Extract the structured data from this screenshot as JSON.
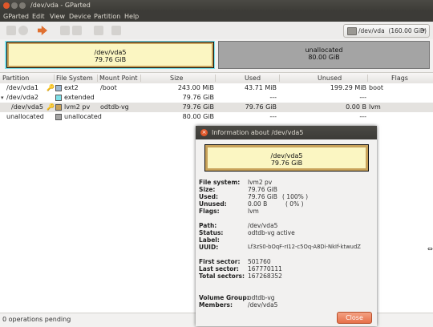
{
  "window": {
    "title": "/dev/vda - GParted"
  },
  "menu": [
    "GParted",
    "Edit",
    "View",
    "Device",
    "Partition",
    "Help"
  ],
  "toolbar": {
    "icons": [
      "new-icon",
      "delete-icon",
      "apply-icon",
      "copy-icon",
      "paste-icon",
      "undo-icon",
      "resize-icon"
    ]
  },
  "device_selector": {
    "label": "/dev/vda",
    "size": "(160.00 GiB)"
  },
  "diskmap": {
    "lvm": {
      "name": "/dev/vda5",
      "size": "79.76 GiB"
    },
    "unallocated": {
      "name": "unallocated",
      "size": "80.00 GiB"
    }
  },
  "table": {
    "headers": [
      "Partition",
      "File System",
      "Mount Point",
      "Size",
      "Used",
      "Unused",
      "Flags"
    ],
    "rows": [
      {
        "partition": "/dev/vda1",
        "fs": "ext2",
        "fs_color": "#9db8d2",
        "mount": "/boot",
        "size": "243.00 MiB",
        "used": "43.71 MiB",
        "unused": "199.29 MiB",
        "flags": "boot",
        "key": "🔑"
      },
      {
        "partition": "/dev/vda2",
        "fs": "extended",
        "fs_color": "#7ee0e8",
        "mount": "",
        "size": "79.76 GiB",
        "used": "---",
        "unused": "---",
        "flags": "",
        "key": ""
      },
      {
        "partition": "/dev/vda5",
        "fs": "lvm2 pv",
        "fs_color": "#c8a25a",
        "mount": "odtdb-vg",
        "size": "79.76 GiB",
        "used": "79.76 GiB",
        "unused": "0.00 B",
        "flags": "lvm",
        "key": "🔑"
      },
      {
        "partition": "unallocated",
        "fs": "unallocated",
        "fs_color": "#a4a4a4",
        "mount": "",
        "size": "80.00 GiB",
        "used": "---",
        "unused": "---",
        "flags": "",
        "key": ""
      }
    ]
  },
  "status": {
    "text": "0 operations pending"
  },
  "dialog": {
    "title": "Information about /dev/vda5",
    "partition_name": "/dev/vda5",
    "partition_size": "79.76 GiB",
    "labels": {
      "filesystem": "File system:",
      "size": "Size:",
      "used": "Used:",
      "unused": "Unused:",
      "flags": "Flags:",
      "path": "Path:",
      "status": "Status:",
      "label": "Label:",
      "uuid": "UUID:",
      "first_sector": "First sector:",
      "last_sector": "Last sector:",
      "total_sectors": "Total sectors:",
      "volume_group": "Volume Group:",
      "members": "Members:"
    },
    "values": {
      "filesystem": "lvm2 pv",
      "size": "79.76 GiB",
      "used": "79.76 GiB",
      "used_pct": "( 100% )",
      "unused": "0.00 B",
      "unused_pct": "( 0% )",
      "flags": "lvm",
      "path": "/dev/vda5",
      "status": "odtdb-vg active",
      "label": "",
      "uuid": "Lf3zS0-bOqF-rI12-c5Oq-A8Di-NkIf-ktwudZ",
      "first_sector": "501760",
      "last_sector": "167770111",
      "total_sectors": "167268352",
      "volume_group": "odtdb-vg",
      "members": "/dev/vda5"
    },
    "close_label": "Close"
  }
}
